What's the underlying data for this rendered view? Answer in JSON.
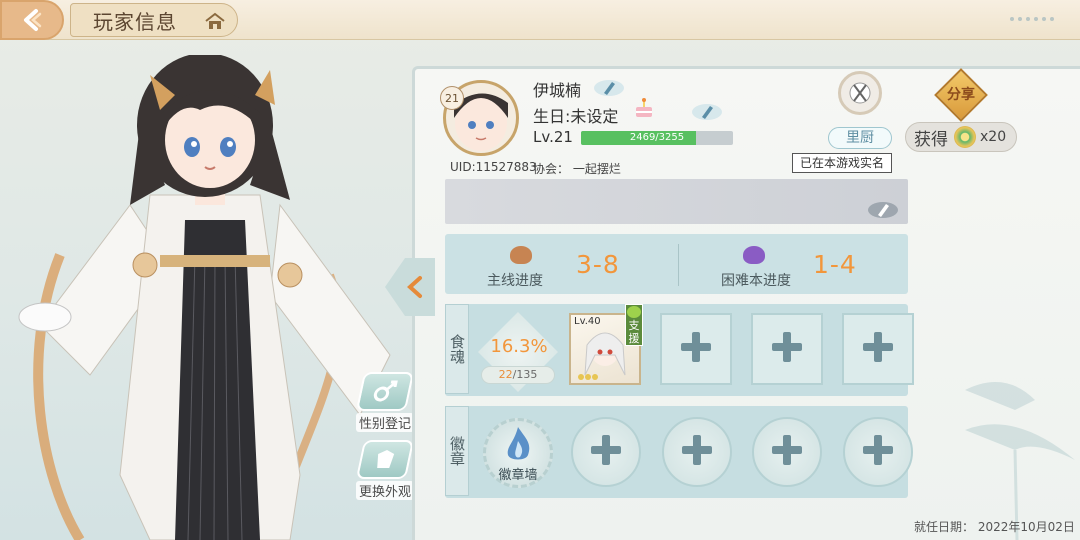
{
  "header": {
    "title": "玩家信息"
  },
  "player": {
    "avatar_level": "21",
    "name": "伊城楠",
    "birthday": "生日:未设定",
    "level": "Lv.21",
    "exp_text": "2469/3255",
    "exp_ratio": 0.7585,
    "uid": "UID:11527883",
    "guild": "协会：   一起摆烂"
  },
  "kitchen": {
    "label": "里厨"
  },
  "realname": {
    "label": "已在本游戏实名"
  },
  "share": {
    "icon_text": "分享",
    "reward_label": "获得",
    "reward_count": "x20"
  },
  "progress": {
    "main": {
      "label": "主线进度",
      "value": "3-8"
    },
    "hard": {
      "label": "困难本进度",
      "value": "1-4"
    }
  },
  "souls": {
    "section_label": "食魂",
    "percent": "16.3%",
    "owned": "22",
    "total": "/135",
    "card": {
      "level": "Lv.40",
      "tag": "支援"
    }
  },
  "badges": {
    "section_label": "徽章",
    "wall_label": "徽章墙"
  },
  "side_buttons": {
    "gender": "性别登记",
    "outfit": "更换外观"
  },
  "footer": {
    "hire_date": "就任日期：   2022年10月02日"
  },
  "colors": {
    "accent_orange": "#f2963b",
    "exp_green": "#58c060",
    "panel_teal": "#c6dee1"
  }
}
